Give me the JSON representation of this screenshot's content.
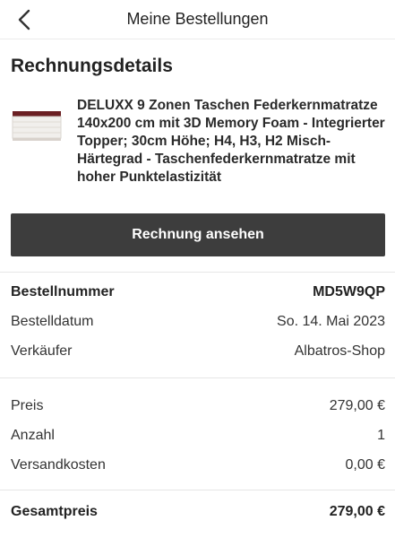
{
  "nav": {
    "title": "Meine Bestellungen",
    "back_icon": "chevron-left-icon"
  },
  "section_title": "Rechnungsdetails",
  "product": {
    "name": "DELUXX 9 Zonen Taschen Federkernmatratze 140x200 cm mit 3D Memory Foam - Integrierter Topper; 30cm Höhe; H4, H3, H2 Misch-Härtegrad - Taschenfederkernmatratze mit hoher Punktelastizität"
  },
  "invoice_button": "Rechnung ansehen",
  "order": {
    "number_label": "Bestellnummer",
    "number_value": "MD5W9QP",
    "date_label": "Bestelldatum",
    "date_value": "So. 14. Mai 2023",
    "seller_label": "Verkäufer",
    "seller_value": "Albatros-Shop"
  },
  "pricing": {
    "price_label": "Preis",
    "price_value": "279,00 €",
    "qty_label": "Anzahl",
    "qty_value": "1",
    "shipping_label": "Versandkosten",
    "shipping_value": "0,00 €",
    "total_label": "Gesamtpreis",
    "total_value": "279,00 €"
  },
  "colors": {
    "button_bg": "#3d3d3d",
    "divider": "#e6e6e6"
  }
}
